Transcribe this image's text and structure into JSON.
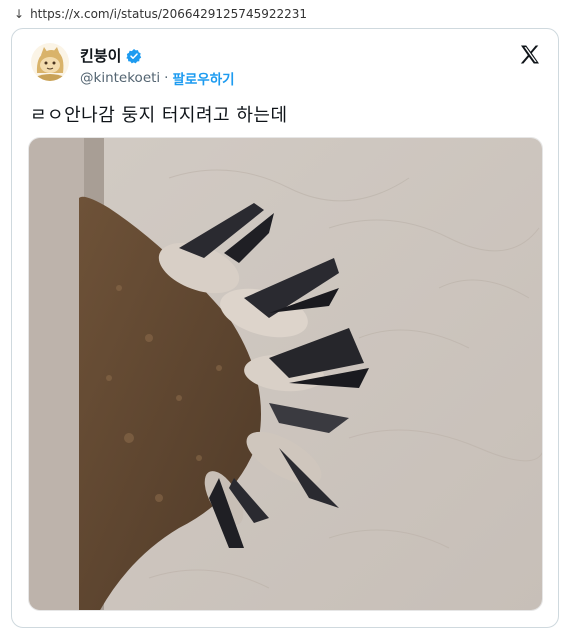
{
  "browser": {
    "url": "https://x.com/i/status/2066429125745922231",
    "download_icon": "download-arrow-icon"
  },
  "tweet": {
    "display_name": "킨붕이",
    "handle": "@kintekoeti",
    "separator": "·",
    "follow_label": "팔로우하기",
    "text": "ㄹㅇ안나감 둥지 터지려고 하는데",
    "verified": true,
    "platform_icon": "x-logo-icon",
    "accent_color": "#1d9bf0"
  },
  "media": {
    "subject": "swallow-chicks-in-mud-nest"
  }
}
